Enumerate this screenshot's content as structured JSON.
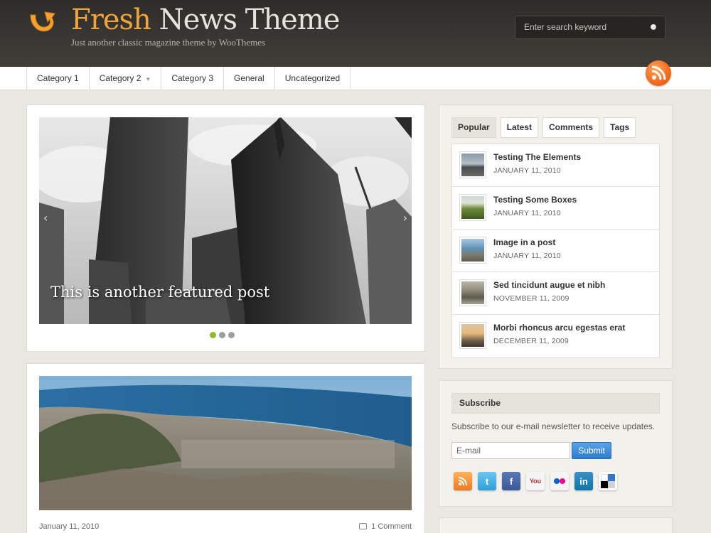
{
  "header": {
    "title_part1": "Fresh",
    "title_part2": "News Theme",
    "tagline": "Just another classic  magazine theme by WooThemes",
    "search_placeholder": "Enter search keyword"
  },
  "nav": {
    "items": [
      "Category 1",
      "Category 2",
      "Category 3",
      "General",
      "Uncategorized"
    ]
  },
  "featured": {
    "caption": "This is another featured post",
    "slides_total": 3,
    "active_slide": 1
  },
  "post": {
    "date": "January 11, 2010",
    "comments": "1 Comment"
  },
  "tabs_widget": {
    "tabs": [
      "Popular",
      "Latest",
      "Comments",
      "Tags"
    ],
    "active_tab": "Popular",
    "items": [
      {
        "title": "Testing The Elements",
        "date": "JANUARY 11, 2010"
      },
      {
        "title": "Testing Some Boxes",
        "date": "JANUARY 11, 2010"
      },
      {
        "title": "Image in a post",
        "date": "JANUARY 11, 2010"
      },
      {
        "title": "Sed tincidunt augue et nibh",
        "date": "NOVEMBER 11, 2009"
      },
      {
        "title": "Morbi rhoncus arcu egestas erat",
        "date": "DECEMBER 11, 2009"
      }
    ]
  },
  "subscribe": {
    "heading": "Subscribe",
    "text": "Subscribe to our e-mail newsletter to receive updates.",
    "email_placeholder": "E-mail",
    "button": "Submit",
    "social_icons": [
      "rss-icon",
      "twitter-icon",
      "facebook-icon",
      "youtube-icon",
      "flickr-icon",
      "linkedin-icon",
      "delicious-icon"
    ]
  },
  "colors": {
    "accent_orange": "#f2a43a",
    "header_bg": "#3a3834",
    "page_bg": "#e9e7e1",
    "active_dot": "#8bbd2e",
    "submit_blue": "#2f7ccd"
  }
}
